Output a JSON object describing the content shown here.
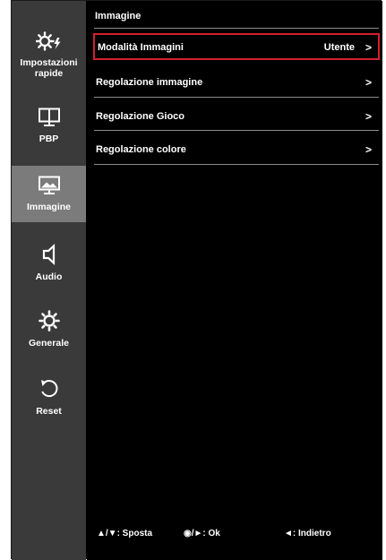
{
  "sidebar": {
    "items": [
      {
        "label": "Impostazioni rapide",
        "icon": "quick-settings-icon",
        "active": false
      },
      {
        "label": "PBP",
        "icon": "pbp-icon",
        "active": false
      },
      {
        "label": "Immagine",
        "icon": "picture-icon",
        "active": true
      },
      {
        "label": "Audio",
        "icon": "speaker-icon",
        "active": false
      },
      {
        "label": "Generale",
        "icon": "gear-icon",
        "active": false
      },
      {
        "label": "Reset",
        "icon": "reset-icon",
        "active": false
      }
    ]
  },
  "panel": {
    "title": "Immagine",
    "rows": [
      {
        "label": "Modalità Immagini",
        "value": "Utente",
        "chevron": ">"
      },
      {
        "label": "Regolazione immagine",
        "value": "",
        "chevron": ">"
      },
      {
        "label": "Regolazione Gioco",
        "value": "",
        "chevron": ">"
      },
      {
        "label": "Regolazione colore",
        "value": "",
        "chevron": ">"
      }
    ]
  },
  "footer": {
    "move": {
      "glyphs": "▲/▼",
      "label": ": Sposta"
    },
    "ok": {
      "glyphs": "◉/►",
      "label": ": Ok"
    },
    "back": {
      "glyphs": "◄",
      "label": ": Indietro"
    }
  },
  "colors": {
    "selection_border": "#d3212f",
    "sidebar_bg": "#3a3a3a",
    "sidebar_active_bg": "#7b7b7b",
    "panel_bg": "#000000"
  }
}
